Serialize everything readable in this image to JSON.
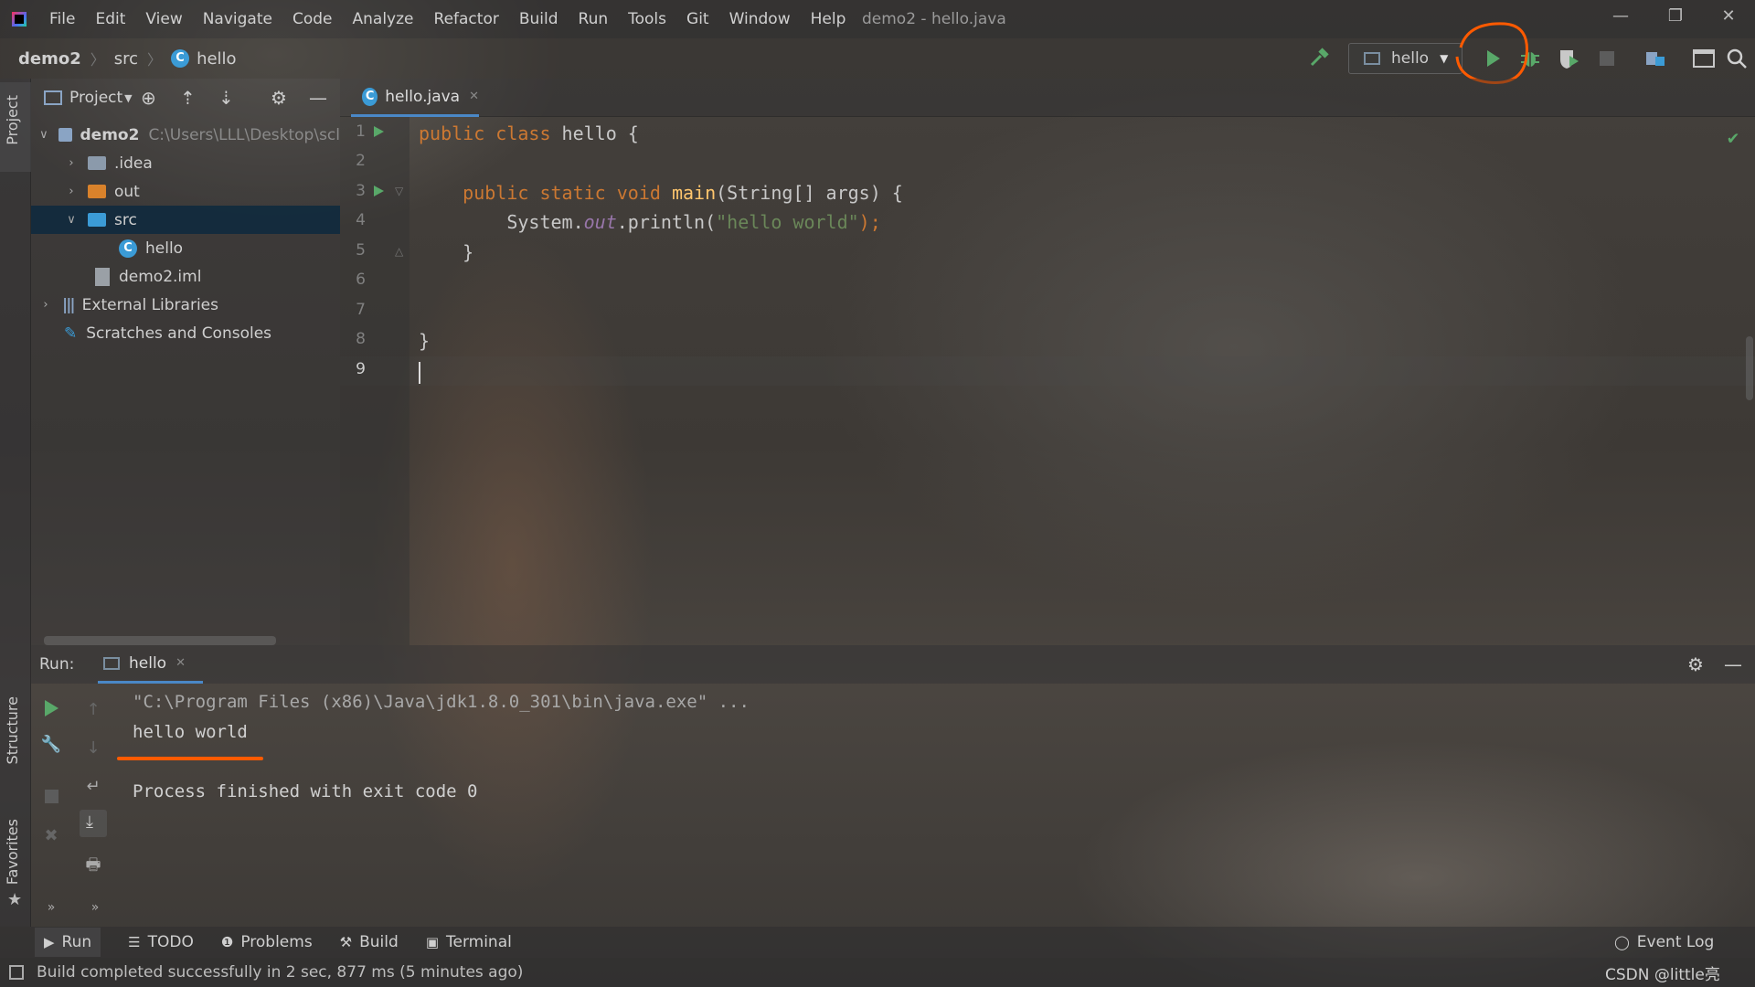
{
  "window": {
    "title": "demo2 - hello.java",
    "menu": [
      "File",
      "Edit",
      "View",
      "Navigate",
      "Code",
      "Analyze",
      "Refactor",
      "Build",
      "Run",
      "Tools",
      "Git",
      "Window",
      "Help"
    ],
    "controls": {
      "minimize": "—",
      "restore": "❐",
      "close": "✕"
    }
  },
  "navbar": {
    "breadcrumb": [
      "demo2",
      "src",
      "hello"
    ],
    "run_config": "hello",
    "icons": [
      "build-hammer-icon",
      "run-icon",
      "debug-icon",
      "coverage-icon",
      "stop-icon",
      "project-structure-icon",
      "terminal-window-icon",
      "search-icon"
    ]
  },
  "left_stripe": {
    "project": "Project",
    "structure": "Structure",
    "favorites": "Favorites"
  },
  "project_panel": {
    "title": "Project",
    "tree": [
      {
        "label": "demo2",
        "path": "C:\\Users\\LLL\\Desktop\\scl",
        "type": "module",
        "expanded": true
      },
      {
        "label": ".idea",
        "type": "folder",
        "expanded": false
      },
      {
        "label": "out",
        "type": "folder-excluded",
        "expanded": false
      },
      {
        "label": "src",
        "type": "folder-source",
        "expanded": true,
        "selected": true
      },
      {
        "label": "hello",
        "type": "class"
      },
      {
        "label": "demo2.iml",
        "type": "file"
      },
      {
        "label": "External Libraries",
        "type": "libraries",
        "expanded": false
      },
      {
        "label": "Scratches and Consoles",
        "type": "scratches"
      }
    ]
  },
  "editor": {
    "tab": "hello.java",
    "line_numbers": [
      "1",
      "2",
      "3",
      "4",
      "5",
      "6",
      "7",
      "8",
      "9"
    ],
    "code": {
      "l1_kw": "public class ",
      "l1_name": "hello {",
      "l3_kw": "    public static void ",
      "l3_fn": "main",
      "l3_rest": "(String[] args) {",
      "l4_a": "        System.",
      "l4_field": "out",
      "l4_b": ".println(",
      "l4_str": "\"hello world\"",
      "l4_end": ");",
      "l5": "    }",
      "l8": "}"
    }
  },
  "run_panel": {
    "label": "Run:",
    "tab": "hello",
    "console": {
      "cmd": "\"C:\\Program Files (x86)\\Java\\jdk1.8.0_301\\bin\\java.exe\" ...",
      "output": "hello world",
      "exit": "Process finished with exit code 0"
    }
  },
  "bottom_tabs": [
    {
      "label": "Run",
      "icon": "▶"
    },
    {
      "label": "TODO",
      "icon": "☰"
    },
    {
      "label": "Problems",
      "icon": "❶"
    },
    {
      "label": "Build",
      "icon": "⚒"
    },
    {
      "label": "Terminal",
      "icon": "▣"
    }
  ],
  "event_log": "Event Log",
  "status": {
    "message": "Build completed successfully in 2 sec, 877 ms (5 minutes ago)",
    "watermark": "CSDN @little亮"
  },
  "colors": {
    "keyword": "#cc7832",
    "function": "#ffc66d",
    "string": "#6a8759",
    "field": "#9876aa",
    "run_green": "#59a869",
    "annotation_orange": "#ff5a00",
    "selection": "#0d293e"
  }
}
